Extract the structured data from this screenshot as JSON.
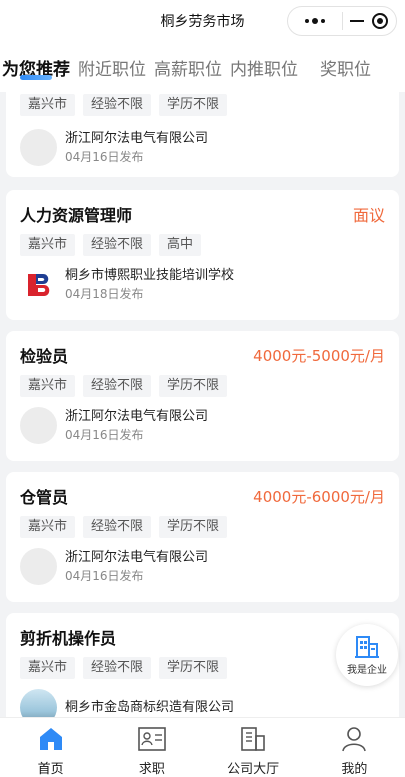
{
  "app": {
    "title": "桐乡劳务市场"
  },
  "tabs": [
    {
      "label": "为您推荐"
    },
    {
      "label": "附近职位"
    },
    {
      "label": "高薪职位"
    },
    {
      "label": "内推职位"
    },
    {
      "label": "奖职位"
    }
  ],
  "cards": [
    {
      "title": "",
      "salary": "",
      "tags": [
        "嘉兴市",
        "经验不限",
        "学历不限"
      ],
      "company": "浙江阿尔法电气有限公司",
      "date": "04月16日发布"
    },
    {
      "title": "人力资源管理师",
      "salary": "面议",
      "tags": [
        "嘉兴市",
        "经验不限",
        "高中"
      ],
      "company": "桐乡市博熙职业技能培训学校",
      "date": "04月18日发布"
    },
    {
      "title": "检验员",
      "salary": "4000元-5000元/月",
      "tags": [
        "嘉兴市",
        "经验不限",
        "学历不限"
      ],
      "company": "浙江阿尔法电气有限公司",
      "date": "04月16日发布"
    },
    {
      "title": "仓管员",
      "salary": "4000元-6000元/月",
      "tags": [
        "嘉兴市",
        "经验不限",
        "学历不限"
      ],
      "company": "浙江阿尔法电气有限公司",
      "date": "04月16日发布"
    },
    {
      "title": "剪折机操作员",
      "salary": "",
      "tags": [
        "嘉兴市",
        "经验不限",
        "学历不限"
      ],
      "company": "桐乡市金岛商标织造有限公司",
      "date": ""
    }
  ],
  "fab": {
    "label": "我是企业"
  },
  "nav": [
    {
      "label": "首页",
      "icon": "home-icon"
    },
    {
      "label": "求职",
      "icon": "resume-icon"
    },
    {
      "label": "公司大厅",
      "icon": "building-icon"
    },
    {
      "label": "我的",
      "icon": "user-icon"
    }
  ],
  "colors": {
    "accent": "#2e8af6",
    "salary": "#f0693c",
    "background": "#f2f3f5"
  }
}
